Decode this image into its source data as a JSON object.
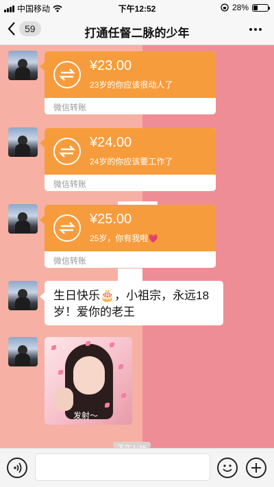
{
  "status_bar": {
    "carrier": "中国移动",
    "time": "下午12:52",
    "battery_percent": "28%",
    "battery_level": 0.28
  },
  "nav": {
    "back_count": "59",
    "title": "打通任督二脉的少年"
  },
  "messages": [
    {
      "type": "transfer",
      "amount": "¥23.00",
      "note": "23岁的你应该很动人了",
      "label": "微信转账"
    },
    {
      "type": "transfer",
      "amount": "¥24.00",
      "note": "24岁的你应该要工作了",
      "label": "微信转账"
    },
    {
      "type": "transfer",
      "amount": "¥25.00",
      "note": "25岁，你有我啦💗",
      "label": "微信转账"
    },
    {
      "type": "text",
      "line1": "生日快乐🎂，小祖宗，永远18",
      "line2": "岁！爱你的老王"
    },
    {
      "type": "image",
      "caption": "发射～"
    }
  ],
  "time_label": "下午1:35",
  "colors": {
    "transfer_orange": "#f79c3c",
    "background_left": "#f6b0a4",
    "background_right": "#ef8d96"
  },
  "icons": [
    "wifi-icon",
    "back-chevron-icon",
    "more-dots-icon",
    "transfer-arrows-icon",
    "voice-icon",
    "emoji-icon",
    "plus-icon",
    "lock-rotation-icon"
  ]
}
